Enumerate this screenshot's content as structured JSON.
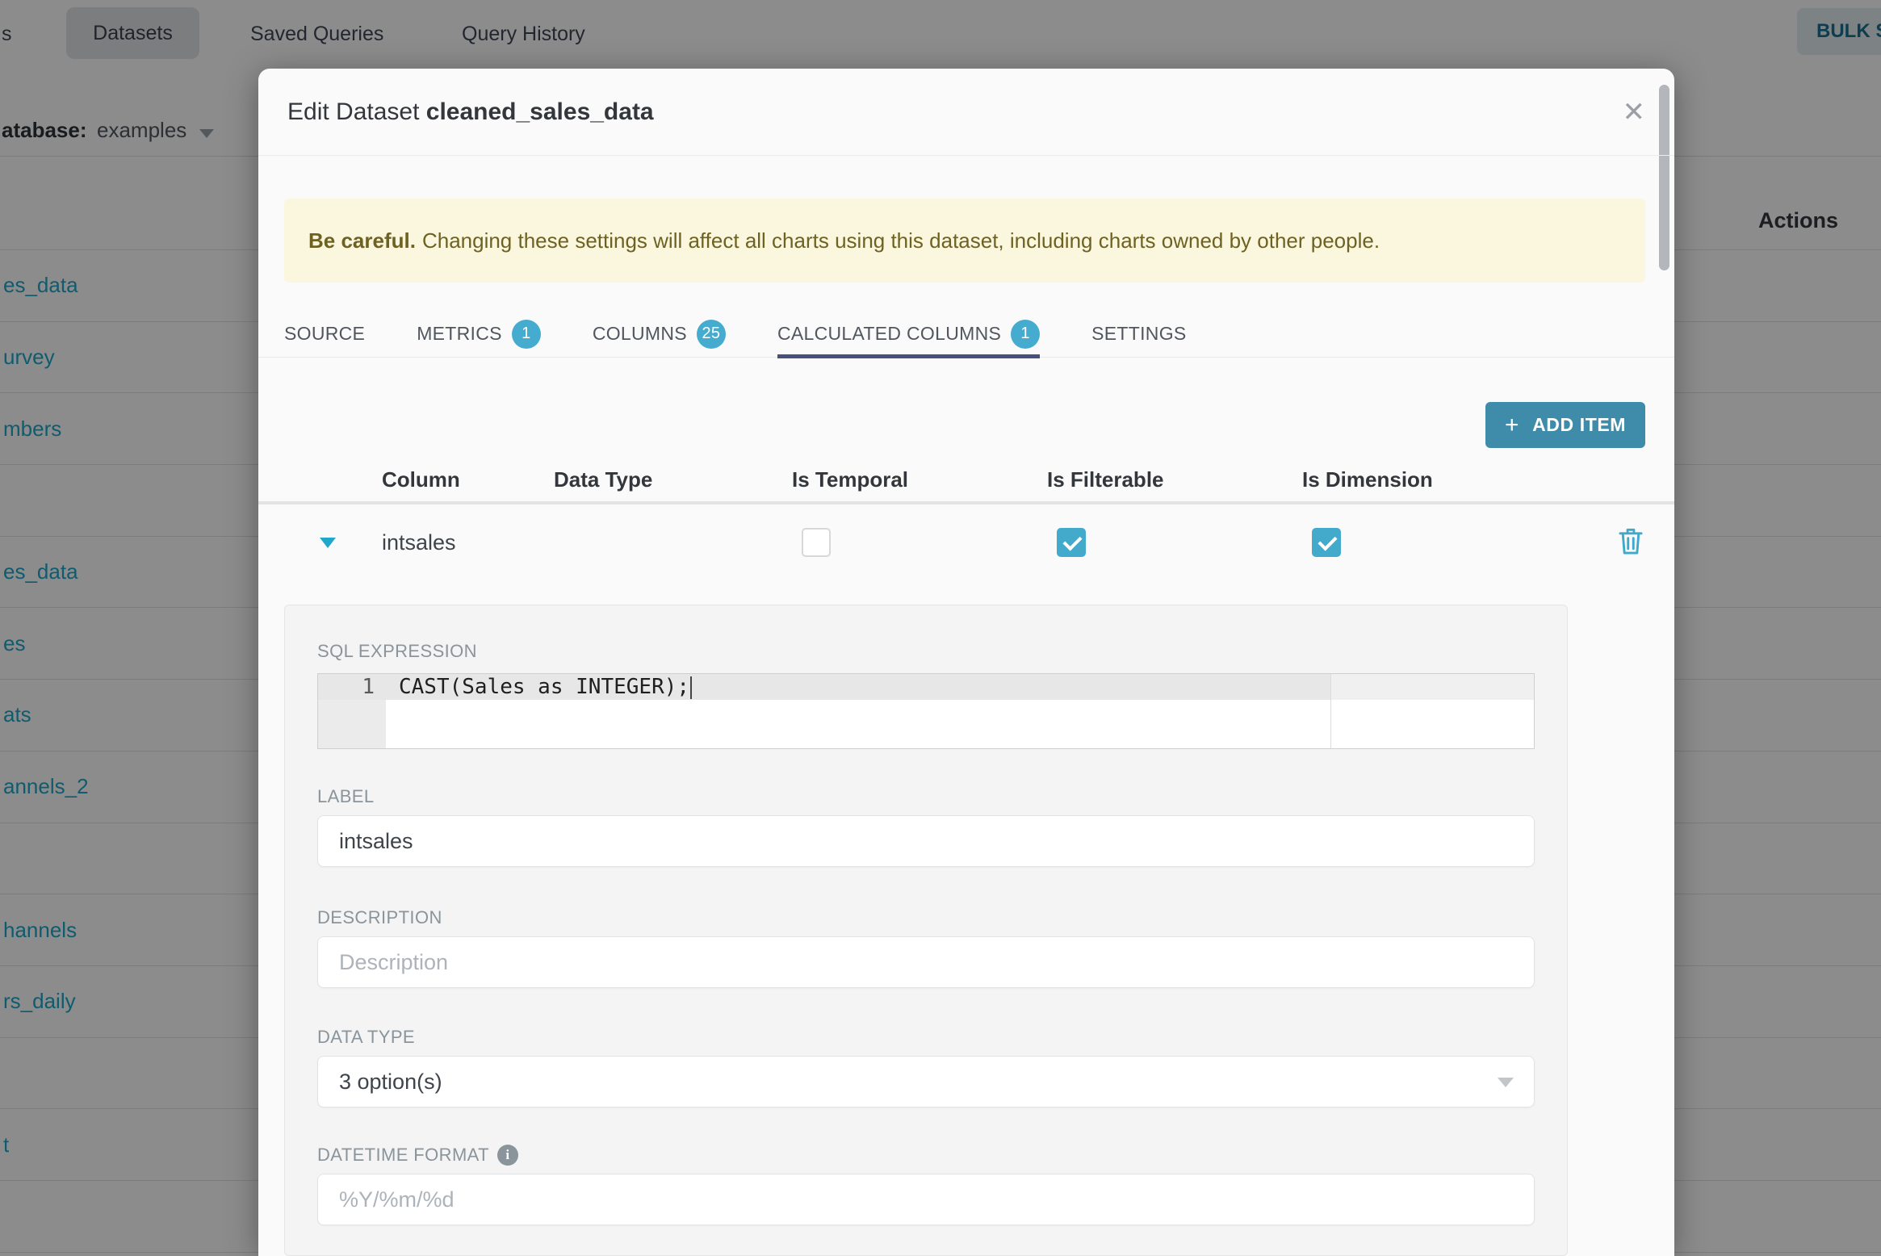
{
  "background": {
    "nav": {
      "partial_tab_fragment": "s",
      "active_tab": "Datasets",
      "tab_saved_queries": "Saved Queries",
      "tab_query_history": "Query History",
      "bulk_select_label": "BULK SELE"
    },
    "subheader": {
      "database_label_fragment": "atabase:",
      "database_value": "examples"
    },
    "table": {
      "actions_header": "Actions",
      "row_fragments": [
        "es_data",
        "urvey",
        "mbers",
        "",
        "es_data",
        "es",
        "ats",
        "annels_2",
        "",
        "hannels",
        "rs_daily",
        "",
        "t",
        ""
      ]
    }
  },
  "modal": {
    "title_prefix": "Edit Dataset",
    "title_dataset": "cleaned_sales_data",
    "close_glyph": "✕",
    "warning": {
      "bold": "Be careful.",
      "text": "Changing these settings will affect all charts using this dataset, including charts owned by other people."
    },
    "tabs": [
      {
        "label": "SOURCE"
      },
      {
        "label": "METRICS",
        "badge": "1"
      },
      {
        "label": "COLUMNS",
        "badge": "25"
      },
      {
        "label": "CALCULATED COLUMNS",
        "badge": "1",
        "active": true
      },
      {
        "label": "SETTINGS"
      }
    ],
    "add_item_label": "ADD ITEM",
    "add_item_plus": "+",
    "columns_table": {
      "headers": [
        "Column",
        "Data Type",
        "Is Temporal",
        "Is Filterable",
        "Is Dimension"
      ],
      "rows": [
        {
          "column": "intsales",
          "is_temporal": false,
          "is_filterable": true,
          "is_dimension": true
        }
      ]
    },
    "editor_panel": {
      "sql_label": "SQL EXPRESSION",
      "sql_line_number": "1",
      "sql_code": "CAST(Sales as INTEGER);",
      "label_field": {
        "label": "LABEL",
        "value": "intsales"
      },
      "description_field": {
        "label": "DESCRIPTION",
        "placeholder": "Description"
      },
      "datatype_field": {
        "label": "DATA TYPE",
        "value": "3 option(s)"
      },
      "datetime_field": {
        "label": "DATETIME FORMAT",
        "placeholder": "%Y/%m/%d"
      }
    }
  },
  "colors": {
    "accent_teal": "#20A7C9",
    "button_teal": "#3E8CAA",
    "badge_blue": "#45ACCF",
    "checkbox_teal": "#44AACB",
    "active_tab_underline": "#474F7D",
    "banner_bg": "#FBF7DF",
    "banner_text": "#6E6222",
    "panel_bg": "#F4F4F4",
    "overlay": "rgba(0,0,0,0.45)"
  }
}
